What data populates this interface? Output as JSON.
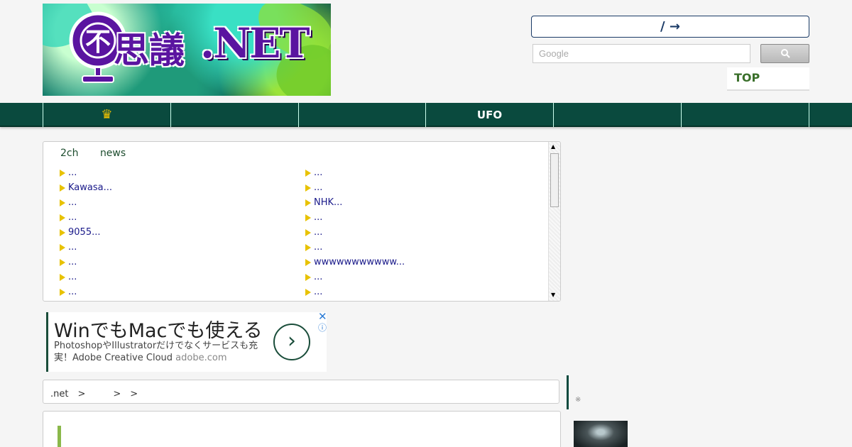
{
  "header": {
    "logo_text": ".NET",
    "logo_kanji": "思議",
    "lang_bar": "/ →",
    "search_placeholder": "Google",
    "top_link": "TOP"
  },
  "nav": {
    "items": [
      "♛",
      "",
      "",
      "UFO",
      "",
      ""
    ]
  },
  "feed": {
    "tabs": [
      "2ch",
      "news"
    ],
    "left": [
      "...",
      "Kawasa...",
      "...",
      "...",
      "9055...",
      "...",
      "...",
      "...",
      "..."
    ],
    "right": [
      "...",
      " ...",
      "NHK...",
      "...",
      "...",
      "...",
      "wwwwwwwwwww...",
      "...",
      "..."
    ]
  },
  "ad": {
    "title": "WinでもMacでも使える",
    "subtitle": "PhotoshopやIllustratorだけでなくサービスも充実！Adobe Creative Cloud",
    "domain": "adobe.com",
    "close": "✕",
    "info": "ⓘ",
    "arrow": "›"
  },
  "breadcrumb": ".net　>　　　>　>",
  "sidebar": {
    "mark": "※"
  }
}
